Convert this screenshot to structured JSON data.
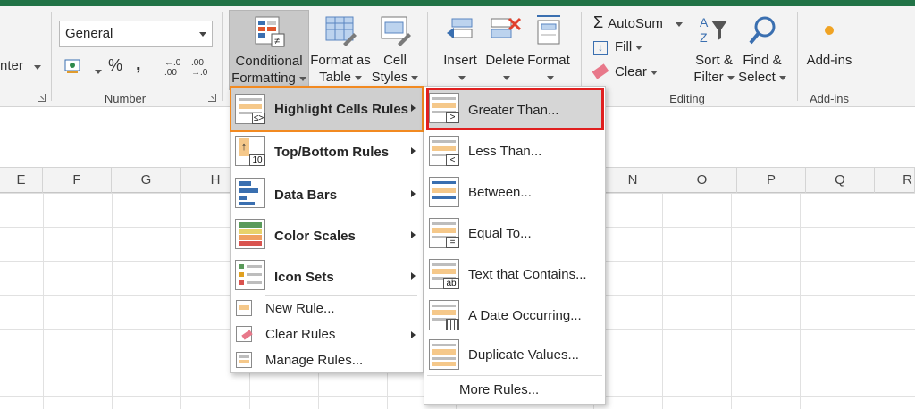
{
  "ribbon": {
    "partial_left_label": "nter",
    "number": {
      "format_value": "General",
      "percent_label": "%",
      "comma_label": ",",
      "inc_decimal_label": "←.0 .00",
      "dec_decimal_label": ".00 →.0",
      "group_label": "Number"
    },
    "styles": {
      "conditional_formatting_label_1": "Conditional",
      "conditional_formatting_label_2": "Formatting",
      "format_as_table_label_1": "Format as",
      "format_as_table_label_2": "Table",
      "cell_styles_label_1": "Cell",
      "cell_styles_label_2": "Styles"
    },
    "cells": {
      "insert_label": "Insert",
      "delete_label": "Delete",
      "format_label": "Format"
    },
    "editing": {
      "autosum_label": "AutoSum",
      "fill_label": "Fill",
      "clear_label": "Clear",
      "sort_filter_label_1": "Sort &",
      "sort_filter_label_2": "Filter",
      "find_select_label_1": "Find &",
      "find_select_label_2": "Select",
      "group_label": "Editing"
    },
    "addins": {
      "addins_label": "Add-ins",
      "group_label": "Add-ins"
    }
  },
  "columns": [
    "E",
    "F",
    "G",
    "H",
    "N",
    "O",
    "P",
    "Q",
    "R"
  ],
  "menu_main": {
    "items": [
      {
        "label": "Highlight Cells Rules",
        "has_submenu": true,
        "active": true
      },
      {
        "label": "Top/Bottom Rules",
        "has_submenu": true
      },
      {
        "label": "Data Bars",
        "has_submenu": true
      },
      {
        "label": "Color Scales",
        "has_submenu": true
      },
      {
        "label": "Icon Sets",
        "has_submenu": true
      }
    ],
    "small_items": [
      {
        "label": "New Rule...",
        "has_submenu": false
      },
      {
        "label": "Clear Rules",
        "has_submenu": true
      },
      {
        "label": "Manage Rules...",
        "has_submenu": false
      }
    ]
  },
  "menu_sub": {
    "items": [
      {
        "label": "Greater Than...",
        "badge": ">",
        "active": true
      },
      {
        "label": "Less Than...",
        "badge": "<"
      },
      {
        "label": "Between...",
        "badge": ""
      },
      {
        "label": "Equal To...",
        "badge": "="
      },
      {
        "label": "Text that Contains...",
        "badge": "ab"
      },
      {
        "label": "A Date Occurring...",
        "badge": "cal"
      },
      {
        "label": "Duplicate Values...",
        "badge": ""
      }
    ],
    "more_label": "More Rules..."
  },
  "colors": {
    "excel_green": "#217346",
    "highlight_orange": "#f28a21",
    "highlight_red": "#e02020",
    "icon_cell_fill": "#f5c88a"
  }
}
